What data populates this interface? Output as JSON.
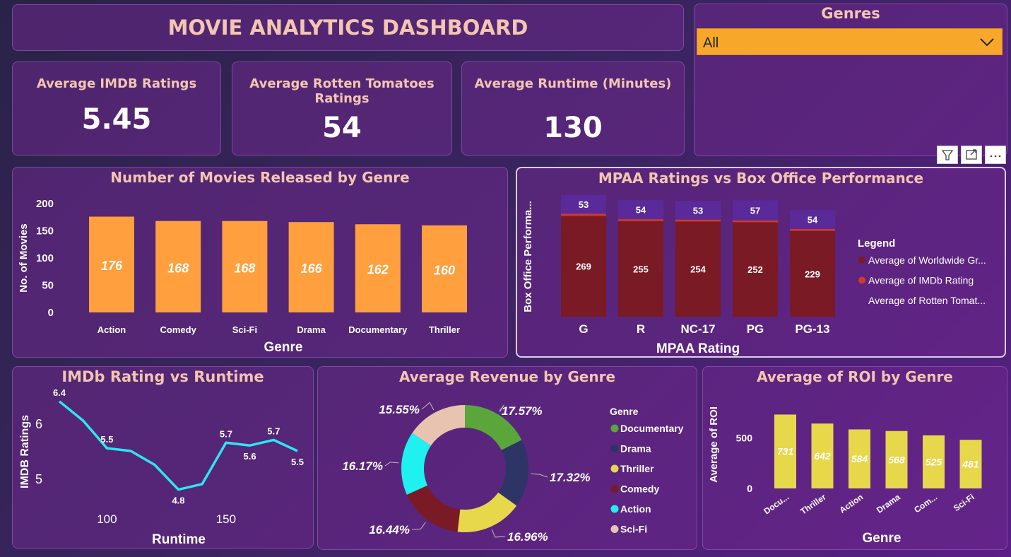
{
  "header": {
    "title": "MOVIE ANALYTICS DASHBOARD"
  },
  "kpis": [
    {
      "label": "Average IMDB Ratings",
      "value": "5.45"
    },
    {
      "label": "Average Rotten Tomatoes Ratings",
      "value": "54"
    },
    {
      "label": "Average Runtime (Minutes)",
      "value": "130"
    }
  ],
  "filter": {
    "title": "Genres",
    "selected": "All"
  },
  "colors": {
    "orange": "#ff9f3d",
    "darkred": "#7a1a24",
    "red": "#d03a2a",
    "cyan": "#2ee6f0",
    "yellow": "#e6d84a",
    "purple": "#5a2a9a"
  },
  "chart_data": [
    {
      "type": "bar",
      "title": "Number of Movies Released by Genre",
      "xlabel": "Genre",
      "ylabel": "No. of Movies",
      "categories": [
        "Action",
        "Comedy",
        "Sci-Fi",
        "Drama",
        "Documentary",
        "Thriller"
      ],
      "values": [
        176,
        168,
        168,
        166,
        162,
        160
      ],
      "yticks": [
        "200",
        "150",
        "100",
        "50",
        "0"
      ],
      "ylim": [
        0,
        200
      ]
    },
    {
      "type": "bar",
      "title": "MPAA Ratings vs Box Office Performance",
      "xlabel": "MPAA Rating",
      "ylabel": "Box Office Performa...",
      "categories": [
        "G",
        "R",
        "NC-17",
        "PG",
        "PG-13"
      ],
      "legend_title": "Legend",
      "series": [
        {
          "name": "Average of Worldwide Gr...",
          "values": [
            269,
            255,
            254,
            252,
            229
          ]
        },
        {
          "name": "Average of IMDb Rating",
          "values": [
            6.4,
            5.5,
            5.5,
            5.4,
            5.5
          ]
        },
        {
          "name": "Average of Rotten Tomat...",
          "values": [
            53,
            54,
            53,
            57,
            54
          ]
        }
      ]
    },
    {
      "type": "line",
      "title": "IMDb Rating vs Runtime",
      "xlabel": "Runtime",
      "ylabel": "IMDB Ratings",
      "x": [
        80,
        90,
        100,
        110,
        120,
        130,
        140,
        150,
        160,
        170,
        180
      ],
      "values": [
        6.4,
        6.05,
        5.55,
        5.5,
        5.25,
        4.8,
        4.9,
        5.65,
        5.6,
        5.7,
        5.5
      ],
      "point_labels": [
        "6.4",
        "",
        "5.5",
        "",
        "",
        "4.8",
        "",
        "5.7",
        "5.6",
        "5.7",
        "5.5"
      ],
      "xticks": [
        "100",
        "150"
      ],
      "yticks": [
        "6",
        "5"
      ]
    },
    {
      "type": "pie",
      "title": "Average Revenue by Genre",
      "legend_title": "Genre",
      "labels": [
        "Documentary",
        "Drama",
        "Thriller",
        "Comedy",
        "Action",
        "Sci-Fi"
      ],
      "values": [
        17.57,
        17.32,
        16.96,
        16.44,
        16.17,
        15.55
      ],
      "value_labels": [
        "17.57%",
        "17.32%",
        "16.96%",
        "16.44%",
        "16.17%",
        "15.55%"
      ],
      "colors": [
        "#5aa63a",
        "#2c3566",
        "#e6d84a",
        "#7a1a24",
        "#1ff0f0",
        "#e8c4b0"
      ]
    },
    {
      "type": "bar",
      "title": "Average of ROI by Genre",
      "xlabel": "Genre",
      "ylabel": "Average of ROI",
      "categories": [
        "Docu...",
        "Thriller",
        "Action",
        "Drama",
        "Com...",
        "Sci-Fi"
      ],
      "values": [
        731,
        642,
        584,
        568,
        525,
        481
      ],
      "yticks": [
        "500",
        "0"
      ]
    }
  ]
}
